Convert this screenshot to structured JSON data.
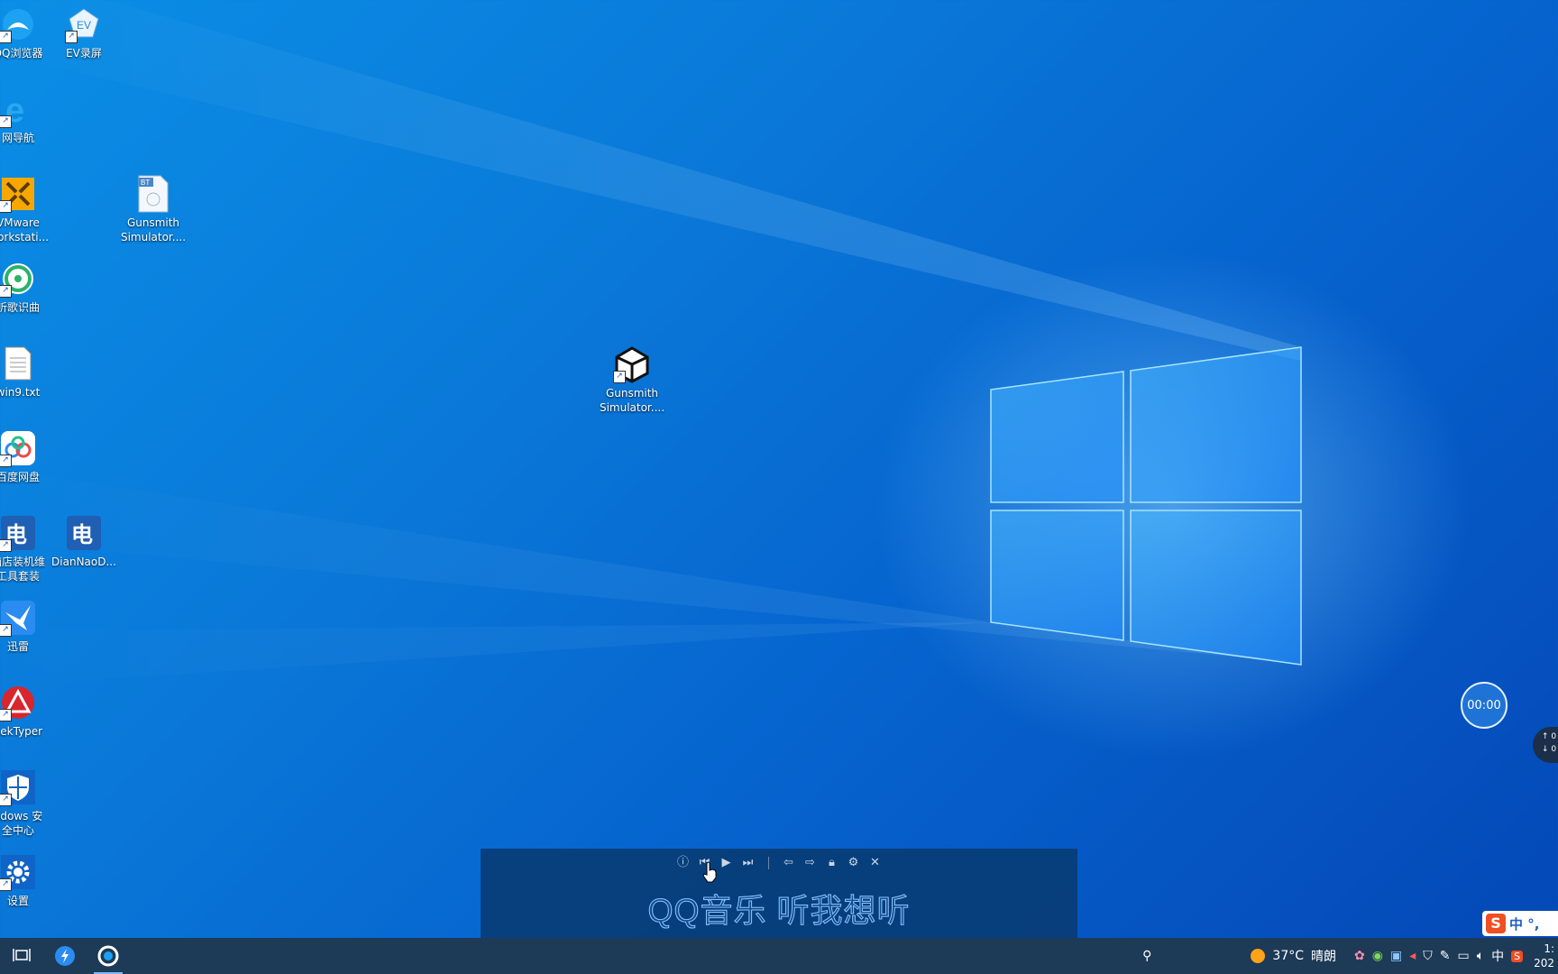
{
  "desktop": {
    "icons": [
      {
        "label": "QQ浏览器",
        "icon": "qq-browser-icon"
      },
      {
        "label": "EV录屏",
        "icon": "ev-recorder-icon"
      },
      {
        "label": "网导航",
        "icon": "ie-icon"
      },
      {
        "label": "VMware\nWorkstati...",
        "icon": "vmware-icon"
      },
      {
        "label": "Gunsmith\nSimulator....",
        "icon": "bt-file-icon"
      },
      {
        "label": "听歌识曲",
        "icon": "music-recognize-icon"
      },
      {
        "label": "win9.txt",
        "icon": "text-file-icon"
      },
      {
        "label": "百度网盘",
        "icon": "baidu-netdisk-icon"
      },
      {
        "label": "脑店装机维\n工具套装",
        "icon": "diannao-tool-icon"
      },
      {
        "label": "DianNaoD...",
        "icon": "diannao-icon"
      },
      {
        "label": "迅雷",
        "icon": "xunlei-icon"
      },
      {
        "label": "eekTyper",
        "icon": "geektyper-icon"
      },
      {
        "label": "ndows 安\n全中心",
        "icon": "windows-security-icon"
      },
      {
        "label": "设置",
        "icon": "settings-gear-icon"
      },
      {
        "label": "Gunsmith\nSimulator....",
        "icon": "unity-icon"
      }
    ]
  },
  "lyric_bar": {
    "text": "QQ音乐 听我想听",
    "controls": [
      "info-icon",
      "previous-icon",
      "play-icon",
      "next-icon",
      "back-icon",
      "forward-icon",
      "lock-icon",
      "settings-icon",
      "close-icon"
    ]
  },
  "timer": {
    "value": "00:00"
  },
  "netspeed": {
    "up": "0",
    "down": "0"
  },
  "ime": {
    "logo": "S",
    "mode": "中 °,"
  },
  "taskbar": {
    "weather_temp": "37°C",
    "weather_desc": "晴朗",
    "input_lang": "中",
    "clock_time": "1:",
    "clock_date": "202"
  },
  "colors": {
    "taskbar": "#1d3a57",
    "accent": "#0a78d8"
  }
}
